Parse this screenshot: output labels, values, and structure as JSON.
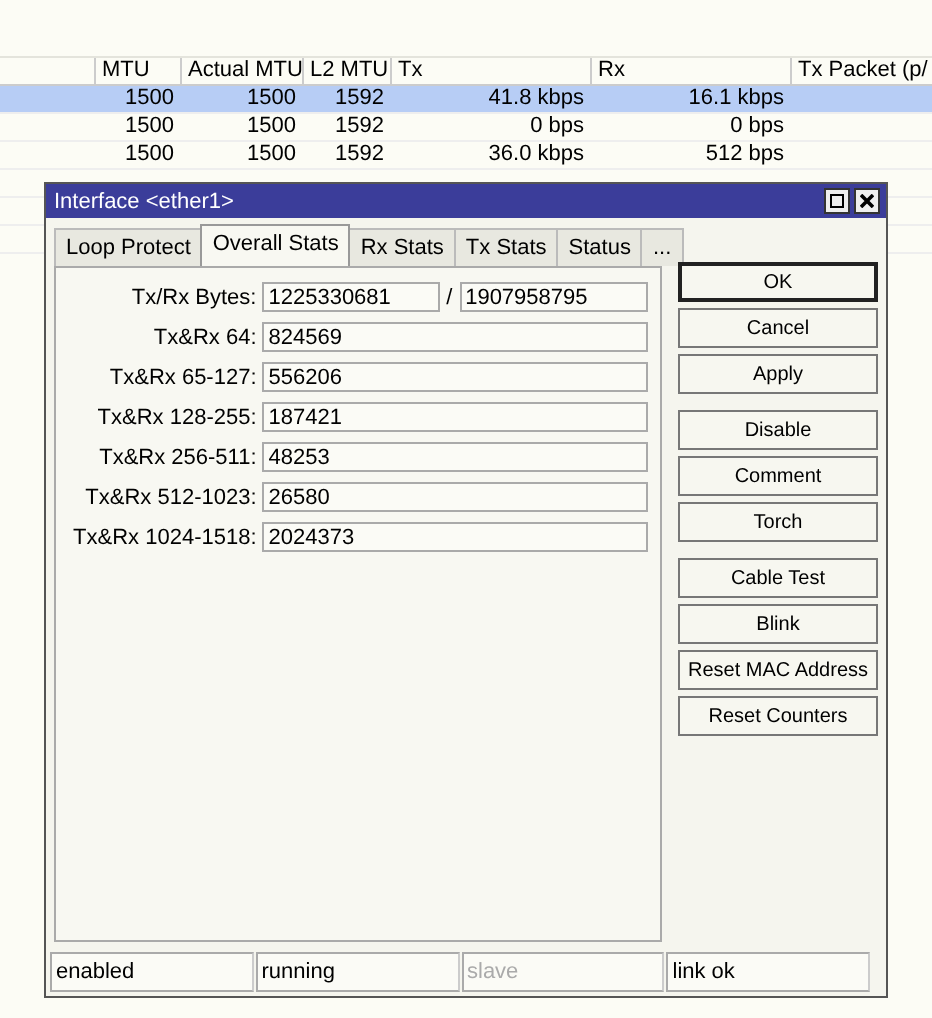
{
  "table": {
    "columns": [
      "MTU",
      "Actual MTU",
      "L2 MTU",
      "Tx",
      "Rx",
      "Tx Packet (p/"
    ],
    "rows": [
      {
        "selected": true,
        "cells": [
          "1500",
          "1500",
          "1592",
          "41.8 kbps",
          "16.1 kbps"
        ]
      },
      {
        "selected": false,
        "cells": [
          "1500",
          "1500",
          "1592",
          "0 bps",
          "0 bps"
        ]
      },
      {
        "selected": false,
        "cells": [
          "1500",
          "1500",
          "1592",
          "36.0 kbps",
          "512 bps"
        ]
      }
    ]
  },
  "dialog": {
    "title": "Interface <ether1>",
    "tabs": [
      {
        "label": "Loop Protect",
        "selected": false
      },
      {
        "label": "Overall Stats",
        "selected": true
      },
      {
        "label": "Rx Stats",
        "selected": false
      },
      {
        "label": "Tx Stats",
        "selected": false
      },
      {
        "label": "Status",
        "selected": false
      },
      {
        "label": "...",
        "selected": false
      }
    ],
    "fields": [
      {
        "label": "Tx/Rx Bytes:",
        "values": [
          "1225330681",
          "1907958795"
        ],
        "separator": "/"
      },
      {
        "label": "Tx&Rx 64:",
        "values": [
          "824569"
        ]
      },
      {
        "label": "Tx&Rx 65-127:",
        "values": [
          "556206"
        ]
      },
      {
        "label": "Tx&Rx 128-255:",
        "values": [
          "187421"
        ]
      },
      {
        "label": "Tx&Rx 256-511:",
        "values": [
          "48253"
        ]
      },
      {
        "label": "Tx&Rx 512-1023:",
        "values": [
          "26580"
        ]
      },
      {
        "label": "Tx&Rx 1024-1518:",
        "values": [
          "2024373"
        ]
      }
    ],
    "button_groups": [
      [
        "OK",
        "Cancel",
        "Apply"
      ],
      [
        "Disable",
        "Comment",
        "Torch"
      ],
      [
        "Cable Test",
        "Blink",
        "Reset MAC Address",
        "Reset Counters"
      ]
    ],
    "status_bar": [
      {
        "text": "enabled",
        "disabled": false
      },
      {
        "text": "running",
        "disabled": false
      },
      {
        "text": "slave",
        "disabled": true
      },
      {
        "text": "link ok",
        "disabled": false
      }
    ]
  }
}
